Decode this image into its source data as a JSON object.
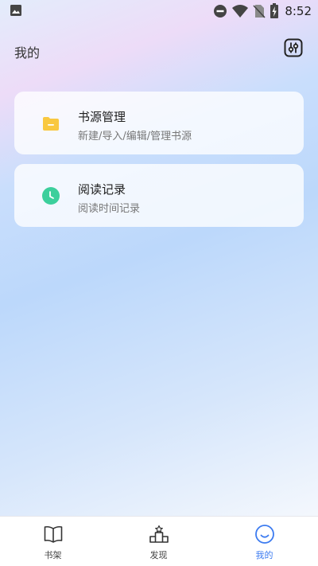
{
  "status_bar": {
    "time": "8:52",
    "icons": [
      "gallery-icon",
      "do-not-disturb-icon",
      "wifi-icon",
      "no-sim-icon",
      "battery-charging-icon"
    ]
  },
  "header": {
    "title": "我的",
    "settings_icon": "settings-sliders-icon"
  },
  "menu": [
    {
      "title": "书源管理",
      "subtitle": "新建/导入/编辑/管理书源",
      "icon": "folder-icon",
      "icon_color": "#f9c840"
    },
    {
      "title": "阅读记录",
      "subtitle": "阅读时间记录",
      "icon": "clock-icon",
      "icon_color": "#3ccf9c"
    }
  ],
  "tabbar": {
    "tabs": [
      {
        "label": "书架",
        "icon": "book-icon",
        "active": false
      },
      {
        "label": "发现",
        "icon": "podium-icon",
        "active": false
      },
      {
        "label": "我的",
        "icon": "smile-icon",
        "active": true
      }
    ],
    "active_color": "#3c7bf0"
  }
}
